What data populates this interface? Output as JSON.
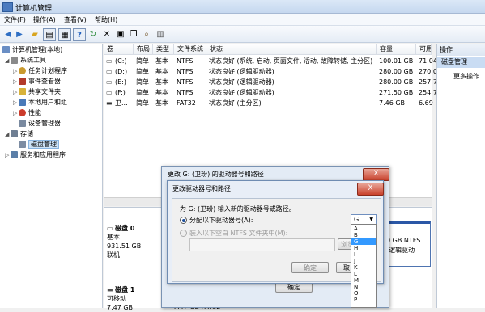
{
  "window": {
    "title": "计算机管理"
  },
  "menu": [
    "文件(F)",
    "操作(A)",
    "查看(V)",
    "帮助(H)"
  ],
  "toolbar_icons": [
    "back-arrow-icon",
    "forward-arrow-icon",
    "folder-icon",
    "console-tree-icon",
    "properties-icon",
    "help-icon",
    "refresh-icon",
    "delete-icon",
    "rename-icon",
    "copy-icon",
    "search-icon",
    "settings-icon"
  ],
  "tree": {
    "root": "计算机管理(本地)",
    "items": [
      {
        "label": "系统工具",
        "level": 1,
        "icon": "tools-icon"
      },
      {
        "label": "任务计划程序",
        "level": 2,
        "icon": "clock-icon"
      },
      {
        "label": "事件查看器",
        "level": 2,
        "icon": "event-icon"
      },
      {
        "label": "共享文件夹",
        "level": 2,
        "icon": "share-folder-icon"
      },
      {
        "label": "本地用户和组",
        "level": 2,
        "icon": "users-icon"
      },
      {
        "label": "性能",
        "level": 2,
        "icon": "performance-icon"
      },
      {
        "label": "设备管理器",
        "level": 2,
        "icon": "device-icon"
      },
      {
        "label": "存储",
        "level": 1,
        "icon": "storage-icon"
      },
      {
        "label": "磁盘管理",
        "level": 2,
        "icon": "disk-icon",
        "selected": true
      },
      {
        "label": "服务和应用程序",
        "level": 1,
        "icon": "services-icon"
      }
    ]
  },
  "volumes": {
    "headers": [
      "卷",
      "布局",
      "类型",
      "文件系统",
      "状态",
      "容量",
      "可用空间",
      "%"
    ],
    "rows": [
      [
        "(C:)",
        "简单",
        "基本",
        "NTFS",
        "状态良好 (系统, 启动, 页面文件, 活动, 故障转储, 主分区)",
        "100.01 GB",
        "71.04",
        ""
      ],
      [
        "(D:)",
        "简单",
        "基本",
        "NTFS",
        "状态良好 (逻辑驱动器)",
        "280.00 GB",
        "270.0",
        ""
      ],
      [
        "(E:)",
        "简单",
        "基本",
        "NTFS",
        "状态良好 (逻辑驱动器)",
        "280.00 GB",
        "257.7",
        ""
      ],
      [
        "(F:)",
        "简单",
        "基本",
        "NTFS",
        "状态良好 (逻辑驱动器)",
        "271.50 GB",
        "254.7",
        ""
      ],
      [
        "卫...",
        "简单",
        "基本",
        "FAT32",
        "状态良好 (主分区)",
        "7.46 GB",
        "6.69",
        ""
      ]
    ]
  },
  "actions": {
    "header": "操作",
    "section": "磁盘管理",
    "more": "更多操作"
  },
  "disks": [
    {
      "name": "磁盘 0",
      "type": "基本",
      "size": "931.51 GB",
      "status": "联机"
    },
    {
      "name": "磁盘 1",
      "type": "可移动",
      "size": "7.47 GB",
      "status": ""
    }
  ],
  "disk_partitions": {
    "d0_right_line1": "0 GB NTFS",
    "d0_right_line2": "(逻辑驱动",
    "d1_bottom": "7.47 GB FAT32"
  },
  "dialog_outer": {
    "title": "更改 G: (卫玢) 的驱动器号和路径",
    "bottom_button": "确定"
  },
  "dialog_inner": {
    "title": "更改驱动器号和路径",
    "prompt": "为 G: (卫玢) 输入新的驱动器号或路径。",
    "option_assign": "分配以下驱动器号(A):",
    "option_mount": "装入以下空白 NTFS 文件夹中(M):",
    "browse": "浏览",
    "ok": "确定",
    "cancel": "取"
  },
  "drive_combo": {
    "value": "G",
    "arrow": "▼"
  },
  "drive_letters": [
    "A",
    "B",
    "G",
    "H",
    "I",
    "J",
    "K",
    "L",
    "M",
    "N",
    "O",
    "P"
  ],
  "close_glyph": "X"
}
